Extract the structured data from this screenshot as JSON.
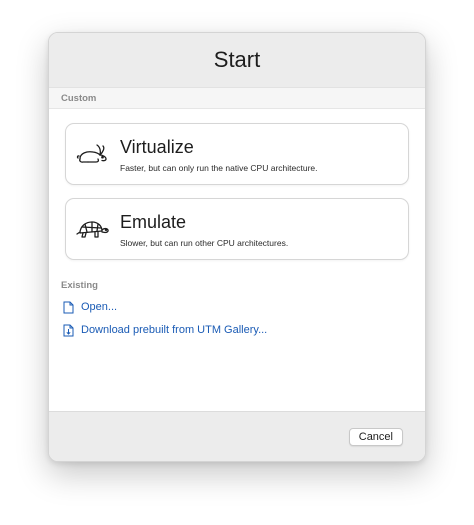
{
  "window": {
    "title": "Start"
  },
  "custom_section": {
    "label": "Custom",
    "options": [
      {
        "title": "Virtualize",
        "description": "Faster, but can only run the native CPU architecture.",
        "icon": "rabbit-icon"
      },
      {
        "title": "Emulate",
        "description": "Slower, but can run other CPU architectures.",
        "icon": "turtle-icon"
      }
    ]
  },
  "existing_section": {
    "label": "Existing",
    "links": [
      {
        "label": "Open...",
        "icon": "document-icon"
      },
      {
        "label": "Download prebuilt from UTM Gallery...",
        "icon": "document-download-icon"
      }
    ]
  },
  "footer": {
    "cancel_label": "Cancel"
  },
  "colors": {
    "link": "#1a5bb5",
    "title_bar": "#ececec",
    "section_header": "#f6f6f6"
  }
}
